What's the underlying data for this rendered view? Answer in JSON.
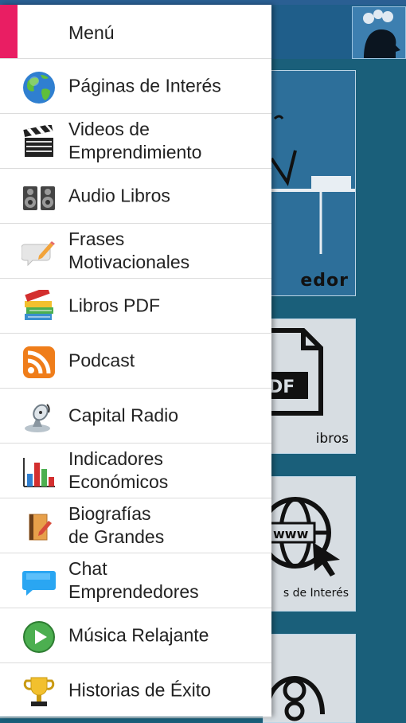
{
  "drawer": {
    "title": "Menú",
    "items": [
      {
        "label": "Páginas de Interés",
        "icon": "globe-icon"
      },
      {
        "label": "Videos de\nEmprendimiento",
        "icon": "clapperboard-icon"
      },
      {
        "label": "Audio Libros",
        "icon": "speakers-icon"
      },
      {
        "label": "Frases\nMotivacionales",
        "icon": "speech-bubble-pencil-icon"
      },
      {
        "label": "Libros PDF",
        "icon": "books-icon"
      },
      {
        "label": "Podcast",
        "icon": "rss-icon"
      },
      {
        "label": "Capital Radio",
        "icon": "radio-antenna-icon"
      },
      {
        "label": "Indicadores\nEconómicos",
        "icon": "bar-chart-icon"
      },
      {
        "label": "Biografías\nde Grandes",
        "icon": "notebook-pencil-icon"
      },
      {
        "label": "Chat\nEmprendedores",
        "icon": "chat-bubble-icon"
      },
      {
        "label": "Música Relajante",
        "icon": "play-circle-icon"
      },
      {
        "label": "Historias de Éxito",
        "icon": "trophy-icon"
      }
    ]
  },
  "background": {
    "tile_1_label": "edor",
    "tile_2_label": "ibros",
    "tile_3_label": "s de Interés"
  },
  "colors": {
    "accent": "#e91e63",
    "background": "#1a5f7a",
    "drawer": "#ffffff"
  }
}
